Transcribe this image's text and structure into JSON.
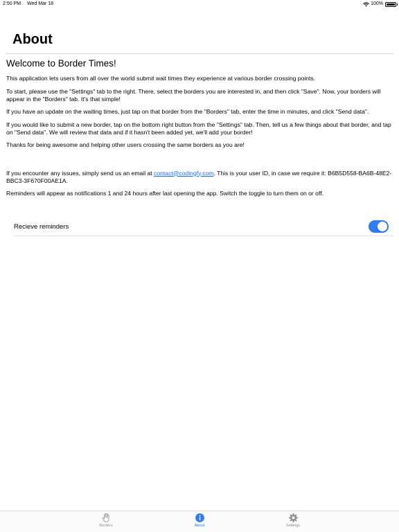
{
  "status_bar": {
    "time": "2:50 PM",
    "date": "Wed Mar 18",
    "battery": "100%"
  },
  "page": {
    "title": "About"
  },
  "content": {
    "heading": "Welcome to Border Times!",
    "paragraphs": [
      "This application lets users from all over the world submit wait times they experience at various border crossing points.",
      "To start, please use the \"Settings\" tab to the right. There, select the borders you are interested in, and then click \"Save\". Now, your borders will appear in the \"Borders\" tab. It's that simple!",
      "If you have an update on the waiting times, just tap on that border from the \"Borders\" tab, enter the time in minutes, and click \"Send data\".",
      "If you would like to submit a new border, tap on the bottom right button from the \"Settings\" tab. Then, tell us a few things about that border, and tap on \"Send data\". We will review that data and if it hasn't been added yet, we'll add your border!",
      "Thanks for being awesome and helping other users crossing the same borders as you are!"
    ],
    "contact": {
      "prefix": "If you encounter any issues, simply send us an email at ",
      "email": "contact@codingfy.com",
      "suffix": ". This is your user ID, in case we require it: B6B5D558-BA6B-48E2-BBC3-3F670F00AE1A."
    },
    "reminders_note": "Reminders will appear as notifications 1 and 24 hours after last opening the app. Switch the toggle to turn them on or off."
  },
  "reminder": {
    "label": "Recieve reminders",
    "enabled": true
  },
  "tabs": [
    {
      "label": "Borders",
      "icon": "hand-icon",
      "active": false
    },
    {
      "label": "About",
      "icon": "info-icon",
      "active": true
    },
    {
      "label": "Settings",
      "icon": "gear-icon",
      "active": false
    }
  ],
  "colors": {
    "accent": "#2f7cf6",
    "inactive_tab": "#8e8e93",
    "link": "#1a6ff2"
  }
}
